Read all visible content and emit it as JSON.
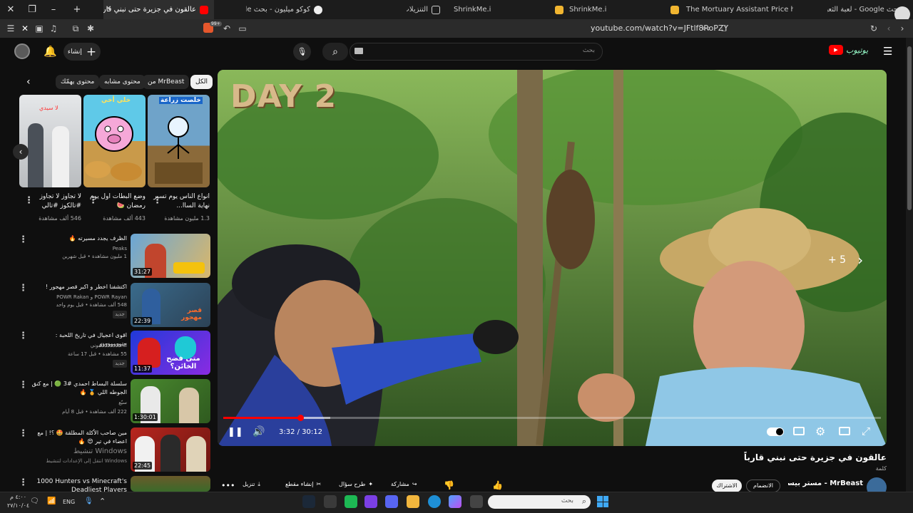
{
  "browser": {
    "tabs": [
      {
        "title": "عالقون في جزيرة حتى نبني قارباً",
        "active": true
      },
      {
        "title": "كوكو ميليون - بحث Google"
      },
      {
        "title": "التنزيلات"
      },
      {
        "title": "ShrinkMe.io"
      },
      {
        "title": "ShrinkMe.io"
      },
      {
        "title": "The Mortuary Assistant Price history"
      },
      {
        "title": "بحث Google - لعبة الثعبان"
      }
    ],
    "url": "youtube.com/watch?v=JFtlf8RoPZY",
    "tab_badge": "99+"
  },
  "yt_header": {
    "search_placeholder": "بحث",
    "create_label": "إنشاء",
    "logo_text": "يوتيوب"
  },
  "chips": [
    "الكل",
    "من MrBeast",
    "محتوى مشابه",
    "محتوى يهمّك"
  ],
  "shorts": [
    {
      "title": "انواع الناس يوم تسير نهاية الساا...",
      "views": "1.3 مليون مشاهدة",
      "badge": "خلصت زراعة"
    },
    {
      "title": "وضع البطات اول يوم رمضان 🍉",
      "views": "443 ألف مشاهدة",
      "badge": "خلي أخي"
    },
    {
      "title": "لا تجاوز لا تجاوز #تالكوز #تالي",
      "views": "546 ألف مشاهدة",
      "badge": "لا سيدي"
    }
  ],
  "recommended": [
    {
      "title": "الظرف يجدد مسيرته 🔥",
      "channel": "Peaks",
      "meta": "1 مليون مشاهدة • قبل شهرين",
      "duration": "31:27"
    },
    {
      "title": "اكتشفنا اخطر و اكبر قصر مهجور !",
      "channel": "POWR Rayan و POWR Rakan",
      "meta": "548 ألف مشاهدة • قبل يوم واحد",
      "duration": "22:39",
      "badge": "جديد",
      "overlay": "قصر مهجور"
    },
    {
      "title": "اقوى اعجيال في تاريخ اللحبة : جتوووووووو",
      "channel": "The Real العوني",
      "meta": "55 مشاهدة • قبل 17 ساعة",
      "duration": "11:37",
      "badge": "جديد",
      "overlay": "متى فضح الخائن؟"
    },
    {
      "title": "سلسلة البساط احمدي #3 🟢 | مع كنق الجوطه اللي 🏅 🔥",
      "channel": "سيّع",
      "meta": "222 ألف مشاهدة • قبل 8 أيام",
      "duration": "1:30:01"
    },
    {
      "title": "مين صاحب الأكلة المطلقة 🤩 ؟! | مع اعضاء في تير 😍 🔥",
      "channel": "Windows تنشيط",
      "meta": "Windows انتقل إلى الإعدادات لتنشيط",
      "duration": "22:45"
    },
    {
      "title": "1000 Hunters vs Minecraft's Deadliest Players",
      "channel": "",
      "meta": "",
      "duration": ""
    }
  ],
  "player": {
    "time": "3:32 / 30:12",
    "progress": 0.117,
    "buffered": 0.163,
    "overlay_text": "DAY 2",
    "next_count": "+ 5"
  },
  "video": {
    "title": "عالقون في جزيرة حتى نبني قارباً",
    "subtitle": "كلمة",
    "channel": "MrBeast - مستر بيست",
    "subscribe": "الاشتراك",
    "joined": "الانضمام",
    "actions": [
      "تنزيل",
      "إنشاء مقطع",
      "طرح سؤال",
      "مشاركة"
    ]
  },
  "taskbar": {
    "search_placeholder": "بحث",
    "lang": "ENG",
    "time": "٤:٠٠ م",
    "date": "٢٧/١٠/٠٤"
  },
  "colors": {
    "yt_red": "#ff0000",
    "accent": "#3ea6ff",
    "progress": "#ff0000"
  }
}
